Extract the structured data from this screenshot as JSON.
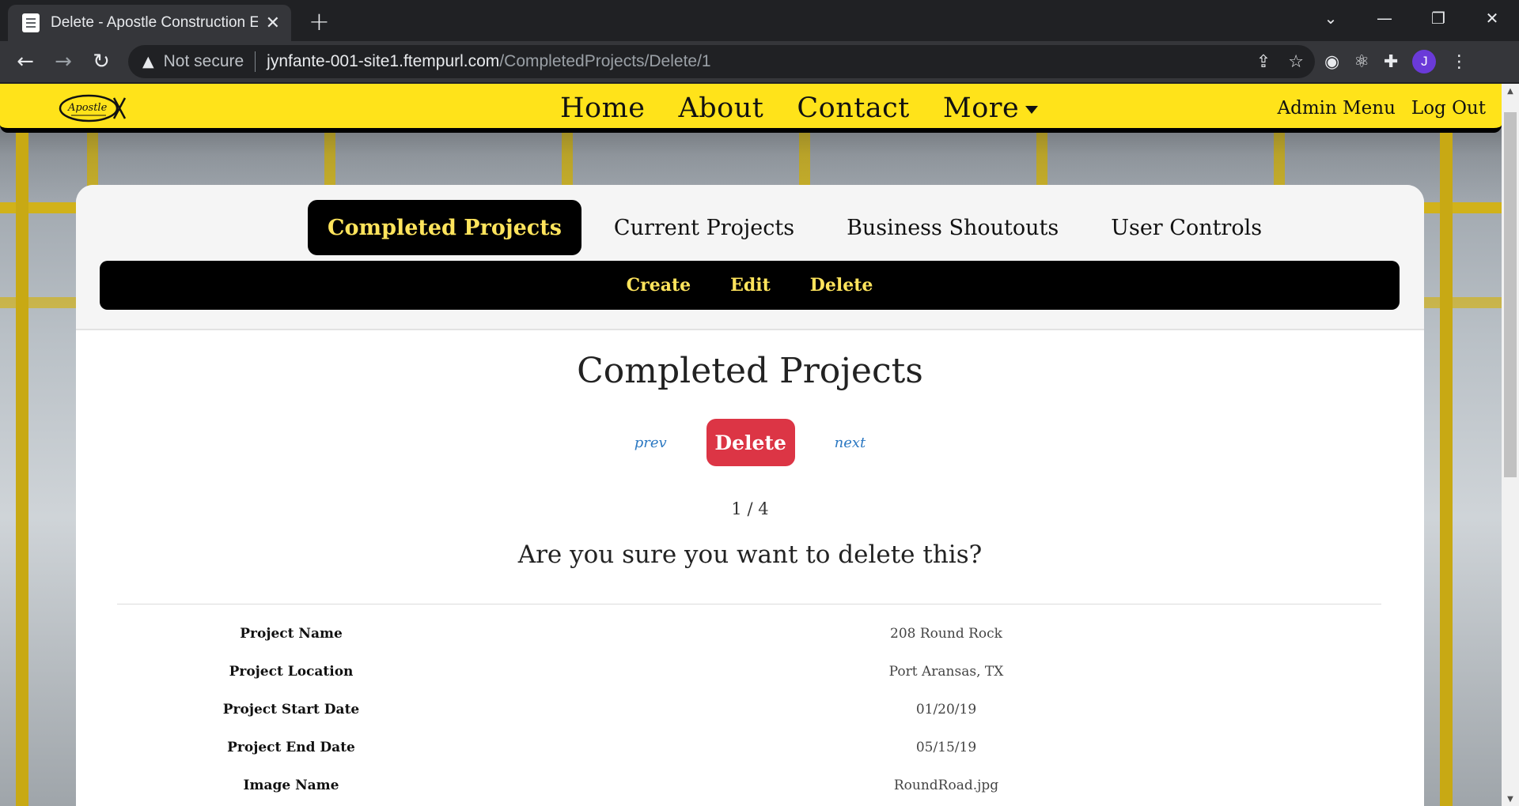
{
  "browser": {
    "tab_title": "Delete - Apostle Construction En",
    "tab_close": "✕",
    "new_tab": "+",
    "security_label": "Not secure",
    "url_host": "jynfante-001-site1.ftempurl.com",
    "url_path": "/CompletedProjects/Delete/1",
    "profile_initial": "J"
  },
  "site": {
    "logo_text": "Apostle",
    "nav": [
      "Home",
      "About",
      "Contact",
      "More"
    ],
    "nav_right": [
      "Admin Menu",
      "Log Out"
    ]
  },
  "tabs": [
    "Completed Projects",
    "Current Projects",
    "Business Shoutouts",
    "User Controls"
  ],
  "active_tab": "Completed Projects",
  "subnav": [
    "Create",
    "Edit",
    "Delete"
  ],
  "page": {
    "title": "Completed Projects",
    "prev": "prev",
    "next": "next",
    "delete_label": "Delete",
    "page_count": "1 / 4",
    "confirm": "Are you sure you want to delete this?"
  },
  "details": [
    {
      "label": "Project Name",
      "value": "208 Round Rock"
    },
    {
      "label": "Project Location",
      "value": "Port Aransas, TX"
    },
    {
      "label": "Project Start Date",
      "value": "01/20/19"
    },
    {
      "label": "Project End Date",
      "value": "05/15/19"
    },
    {
      "label": "Image Name",
      "value": "RoundRoad.jpg"
    }
  ],
  "colors": {
    "navbar": "#ffe31a",
    "accent_text": "#ffe45c",
    "delete": "#dc3545",
    "link": "#2b78c2"
  }
}
